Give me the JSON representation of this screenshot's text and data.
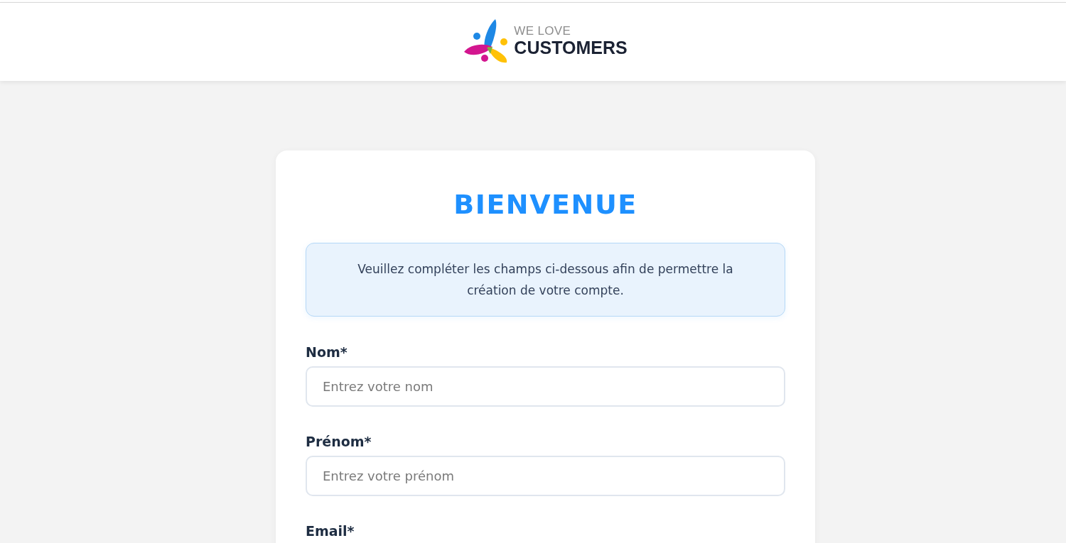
{
  "header": {
    "logo": {
      "line_1": "WE LOVE",
      "line_2": "CUSTOMERS"
    }
  },
  "card": {
    "title": "BIENVENUE",
    "notice": "Veuillez compléter les champs ci-dessous afin de permettre la création de votre compte.",
    "fields": [
      {
        "label": "Nom*",
        "placeholder": "Entrez votre nom"
      },
      {
        "label": "Prénom*",
        "placeholder": "Entrez votre prénom"
      },
      {
        "label": "Email*"
      }
    ]
  }
}
